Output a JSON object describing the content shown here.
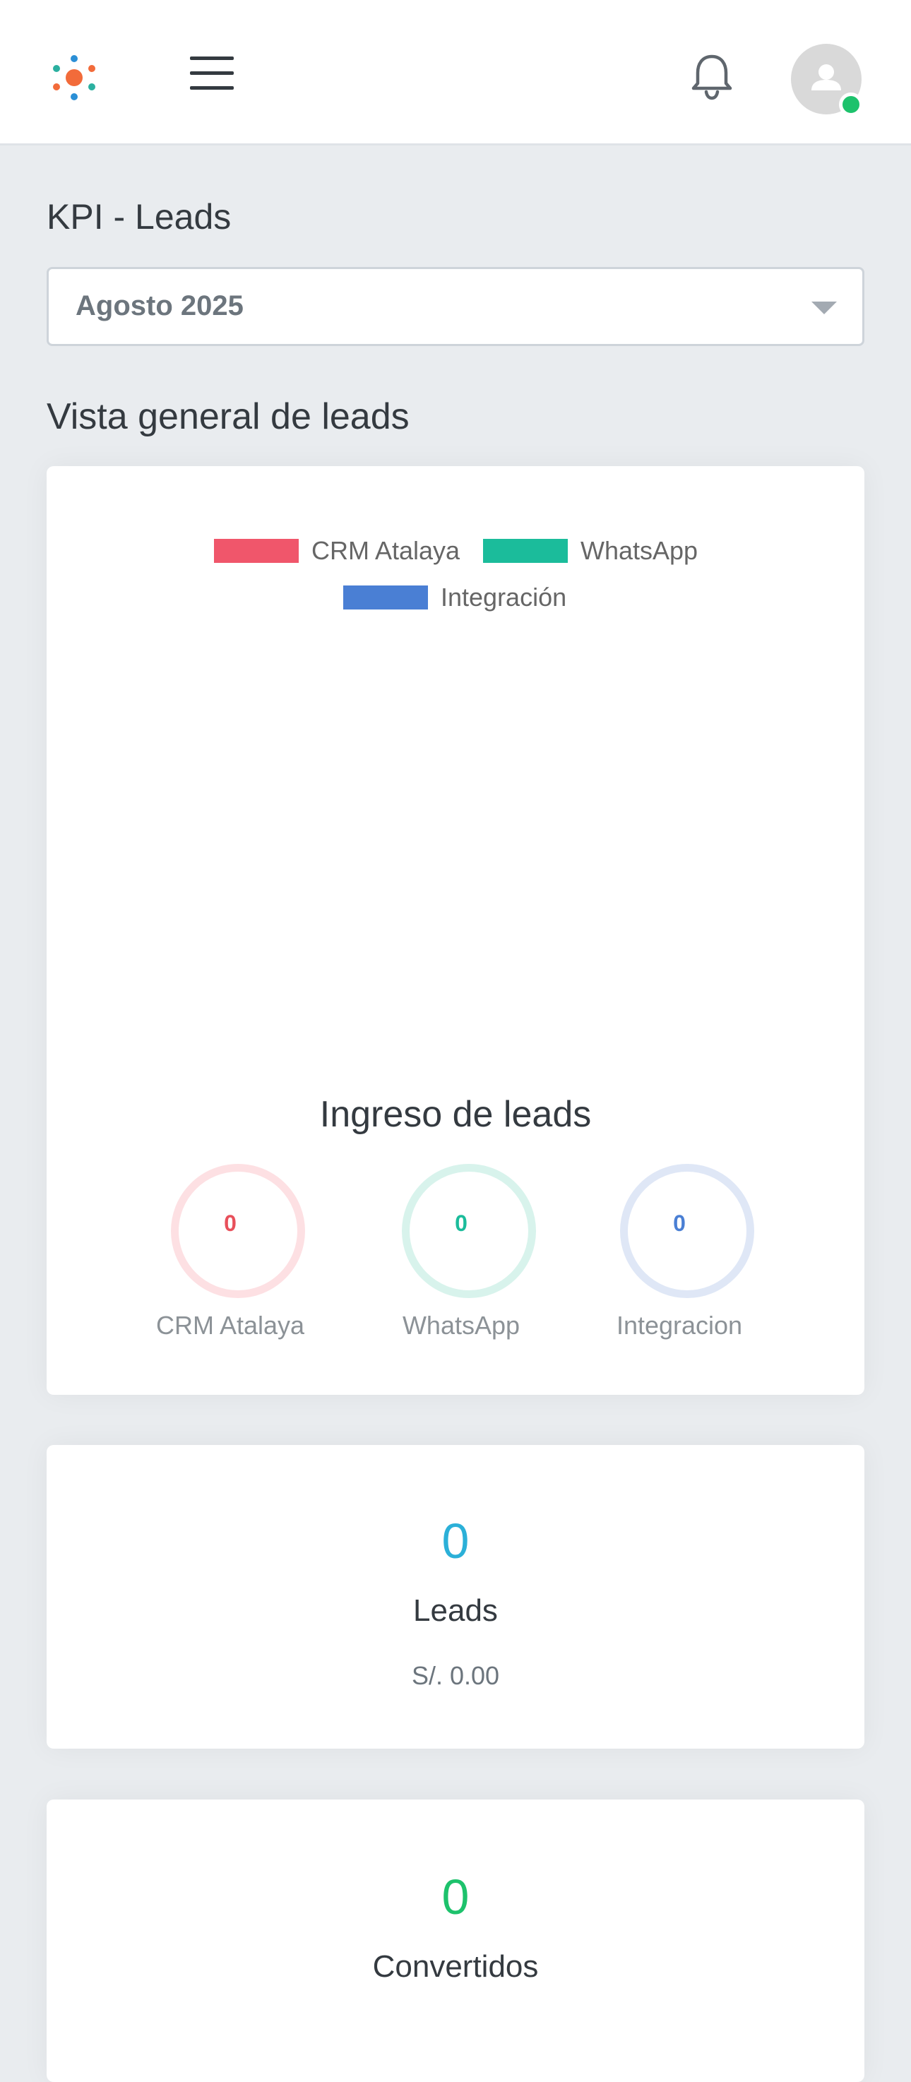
{
  "header": {
    "logo_icon": "app-logo-icon",
    "menu_icon": "hamburger-menu-icon",
    "notifications_icon": "bell-icon",
    "avatar_icon": "user-avatar-icon",
    "online_status_color": "#1dc26c"
  },
  "page": {
    "title": "KPI - Leads"
  },
  "period_select": {
    "selected": "Agosto 2025"
  },
  "overview": {
    "title": "Vista general de leads",
    "legend": [
      {
        "label": "CRM Atalaya",
        "color": "#f0566b"
      },
      {
        "label": "WhatsApp",
        "color": "#1bbc9b"
      },
      {
        "label": "Integración",
        "color": "#4a7fd4"
      }
    ],
    "ingreso": {
      "title": "Ingreso de leads",
      "sources": [
        {
          "label": "CRM Atalaya",
          "value": "0",
          "color": "#e8505b",
          "ring": "#fde0e3"
        },
        {
          "label": "WhatsApp",
          "value": "0",
          "color": "#1bbc9b",
          "ring": "#d8f3ec"
        },
        {
          "label": "Integracion",
          "value": "0",
          "color": "#4a7fd4",
          "ring": "#dfe7f6"
        }
      ]
    }
  },
  "chart_data": {
    "type": "bar",
    "categories": [],
    "series": [
      {
        "name": "CRM Atalaya",
        "values": []
      },
      {
        "name": "WhatsApp",
        "values": []
      },
      {
        "name": "Integración",
        "values": []
      }
    ],
    "title": "",
    "legend": "top-center"
  },
  "leads_card": {
    "value": "0",
    "label": "Leads",
    "amount": "S/. 0.00",
    "value_color": "#2bb0d8"
  },
  "converted_card": {
    "value": "0",
    "label": "Convertidos",
    "value_color": "#1dc26c"
  }
}
